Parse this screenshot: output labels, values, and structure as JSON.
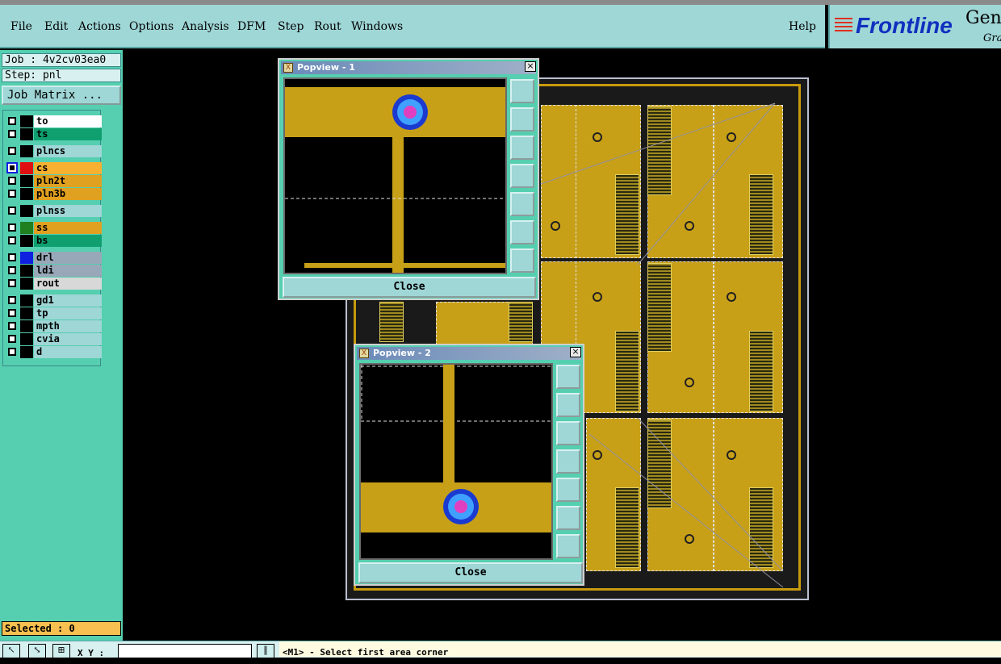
{
  "menu": {
    "items": [
      "File",
      "Edit",
      "Actions",
      "Options",
      "Analysis",
      "DFM",
      "Step",
      "Rout",
      "Windows"
    ],
    "help": "Help",
    "brand": "Frontline",
    "brand_sub_1": "Gen",
    "brand_sub_2": "Gra"
  },
  "job": {
    "job_line": "Job : 4v2cv03ea0",
    "step_line": "Step: pnl",
    "job_matrix_button": "Job Matrix ..."
  },
  "layers": [
    {
      "name": "to",
      "color": "#ffffff",
      "swatch": "#000000",
      "active": false
    },
    {
      "name": "ts",
      "color": "#10a070",
      "swatch": "#000000",
      "active": false
    },
    {
      "name": "plncs",
      "color": "#9fd6d6",
      "swatch": "#000000",
      "active": false
    },
    {
      "name": "cs",
      "color": "#f8b030",
      "swatch": "#e01010",
      "active": true
    },
    {
      "name": "pln2t",
      "color": "#e0a020",
      "swatch": "#000000",
      "active": false
    },
    {
      "name": "pln3b",
      "color": "#e0a020",
      "swatch": "#000000",
      "active": false
    },
    {
      "name": "plnss",
      "color": "#9fd6d6",
      "swatch": "#000000",
      "active": false
    },
    {
      "name": "ss",
      "color": "#e0a020",
      "swatch": "#208020",
      "active": false
    },
    {
      "name": "bs",
      "color": "#10a070",
      "swatch": "#000000",
      "active": false
    },
    {
      "name": "drl",
      "color": "#98a8b8",
      "swatch": "#1020e0",
      "active": false
    },
    {
      "name": "ldi",
      "color": "#98a8b8",
      "swatch": "#000000",
      "active": false
    },
    {
      "name": "rout",
      "color": "#d8d8d8",
      "swatch": "#000000",
      "active": false
    },
    {
      "name": "gd1",
      "color": "#9fd6d6",
      "swatch": "#000000",
      "active": false
    },
    {
      "name": "tp",
      "color": "#9fd6d6",
      "swatch": "#000000",
      "active": false
    },
    {
      "name": "mpth",
      "color": "#9fd6d6",
      "swatch": "#000000",
      "active": false
    },
    {
      "name": "cvia",
      "color": "#9fd6d6",
      "swatch": "#000000",
      "active": false
    },
    {
      "name": "d",
      "color": "#9fd6d6",
      "swatch": "#000000",
      "active": false
    }
  ],
  "selected": "Selected : 0",
  "status": {
    "xy_label": "X Y :",
    "xy_value": "",
    "prompt": "<M1> - Select first area corner"
  },
  "popview1": {
    "title": "Popview - 1",
    "close_label": "Close",
    "close_x": "×"
  },
  "popview2": {
    "title": "Popview - 2",
    "close_label": "Close",
    "close_x": "×"
  },
  "colors": {
    "copper": "#c8a018",
    "pad_outer": "#1a3ad0",
    "pad_mid": "#40a0ff",
    "pad_inner": "#e040c0",
    "panel_bg": "#55cfb0",
    "menu_bg": "#9fd6d6"
  }
}
